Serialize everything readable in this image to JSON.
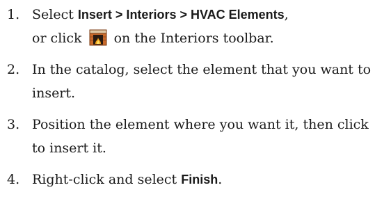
{
  "steps": [
    {
      "number": "1.",
      "select_prefix": "Select ",
      "menu_path": "Insert > Interiors > HVAC Elements",
      "after_menu": ",",
      "line2_before_icon": "or click",
      "icon": "fireplace-icon",
      "line2_after_icon": "on the Interiors toolbar."
    },
    {
      "number": "2.",
      "text": "In the catalog, select the element that you want to insert."
    },
    {
      "number": "3.",
      "text": "Position the element where you want it, then click to insert it."
    },
    {
      "number": "4.",
      "text_before": "Right-click and select ",
      "command": "Finish",
      "text_after": "."
    }
  ],
  "colors": {
    "text": "#1a1a1a",
    "icon_brick": "#b25a22",
    "icon_fire": "#f2a21a"
  }
}
